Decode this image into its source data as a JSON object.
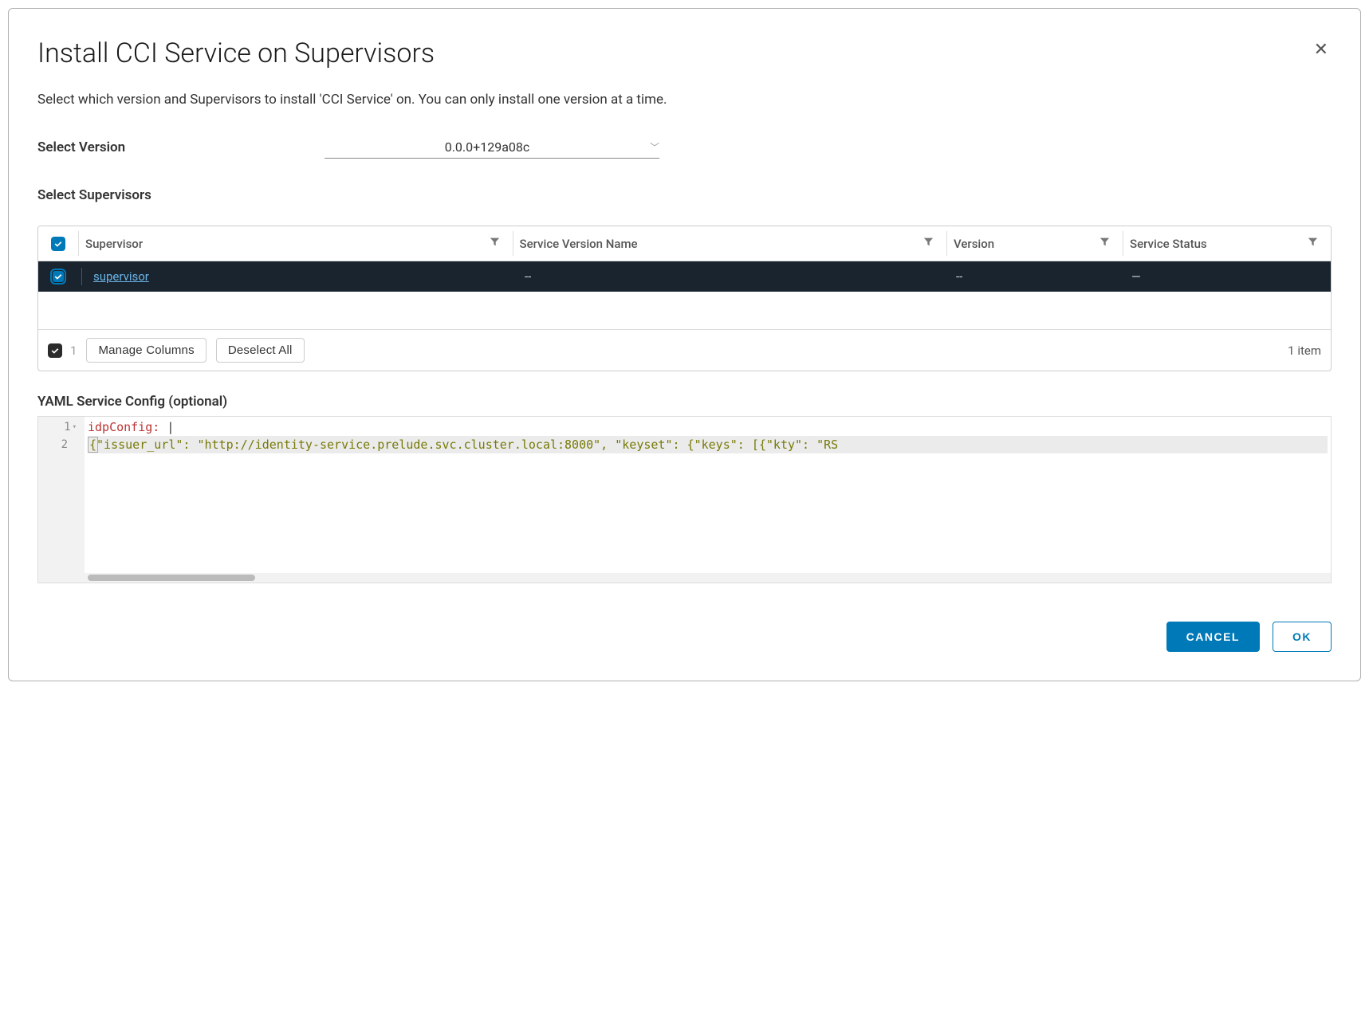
{
  "modal": {
    "title": "Install CCI Service on Supervisors",
    "subtitle": "Select which version and Supervisors to install 'CCI Service' on. You can only install one version at a time."
  },
  "version": {
    "label": "Select Version",
    "value": "0.0.0+129a08c"
  },
  "supervisors": {
    "label": "Select Supervisors",
    "columns": [
      "Supervisor",
      "Service Version Name",
      "Version",
      "Service Status"
    ],
    "rows": [
      {
        "name": "supervisor",
        "svcVersion": "--",
        "version": "--",
        "status": "—"
      }
    ],
    "selected_count": "1",
    "manage_columns": "Manage Columns",
    "deselect_all": "Deselect All",
    "item_count": "1 item"
  },
  "yaml": {
    "label": "YAML Service Config (optional)",
    "line1_key": "idpConfig:",
    "line1_rest": " |",
    "line2_prefix": "  ",
    "line2_content": "{\"issuer_url\": \"http://identity-service.prelude.svc.cluster.local:8000\", \"keyset\": {\"keys\": [{\"kty\": \"RS"
  },
  "footer": {
    "cancel": "CANCEL",
    "ok": "OK"
  }
}
